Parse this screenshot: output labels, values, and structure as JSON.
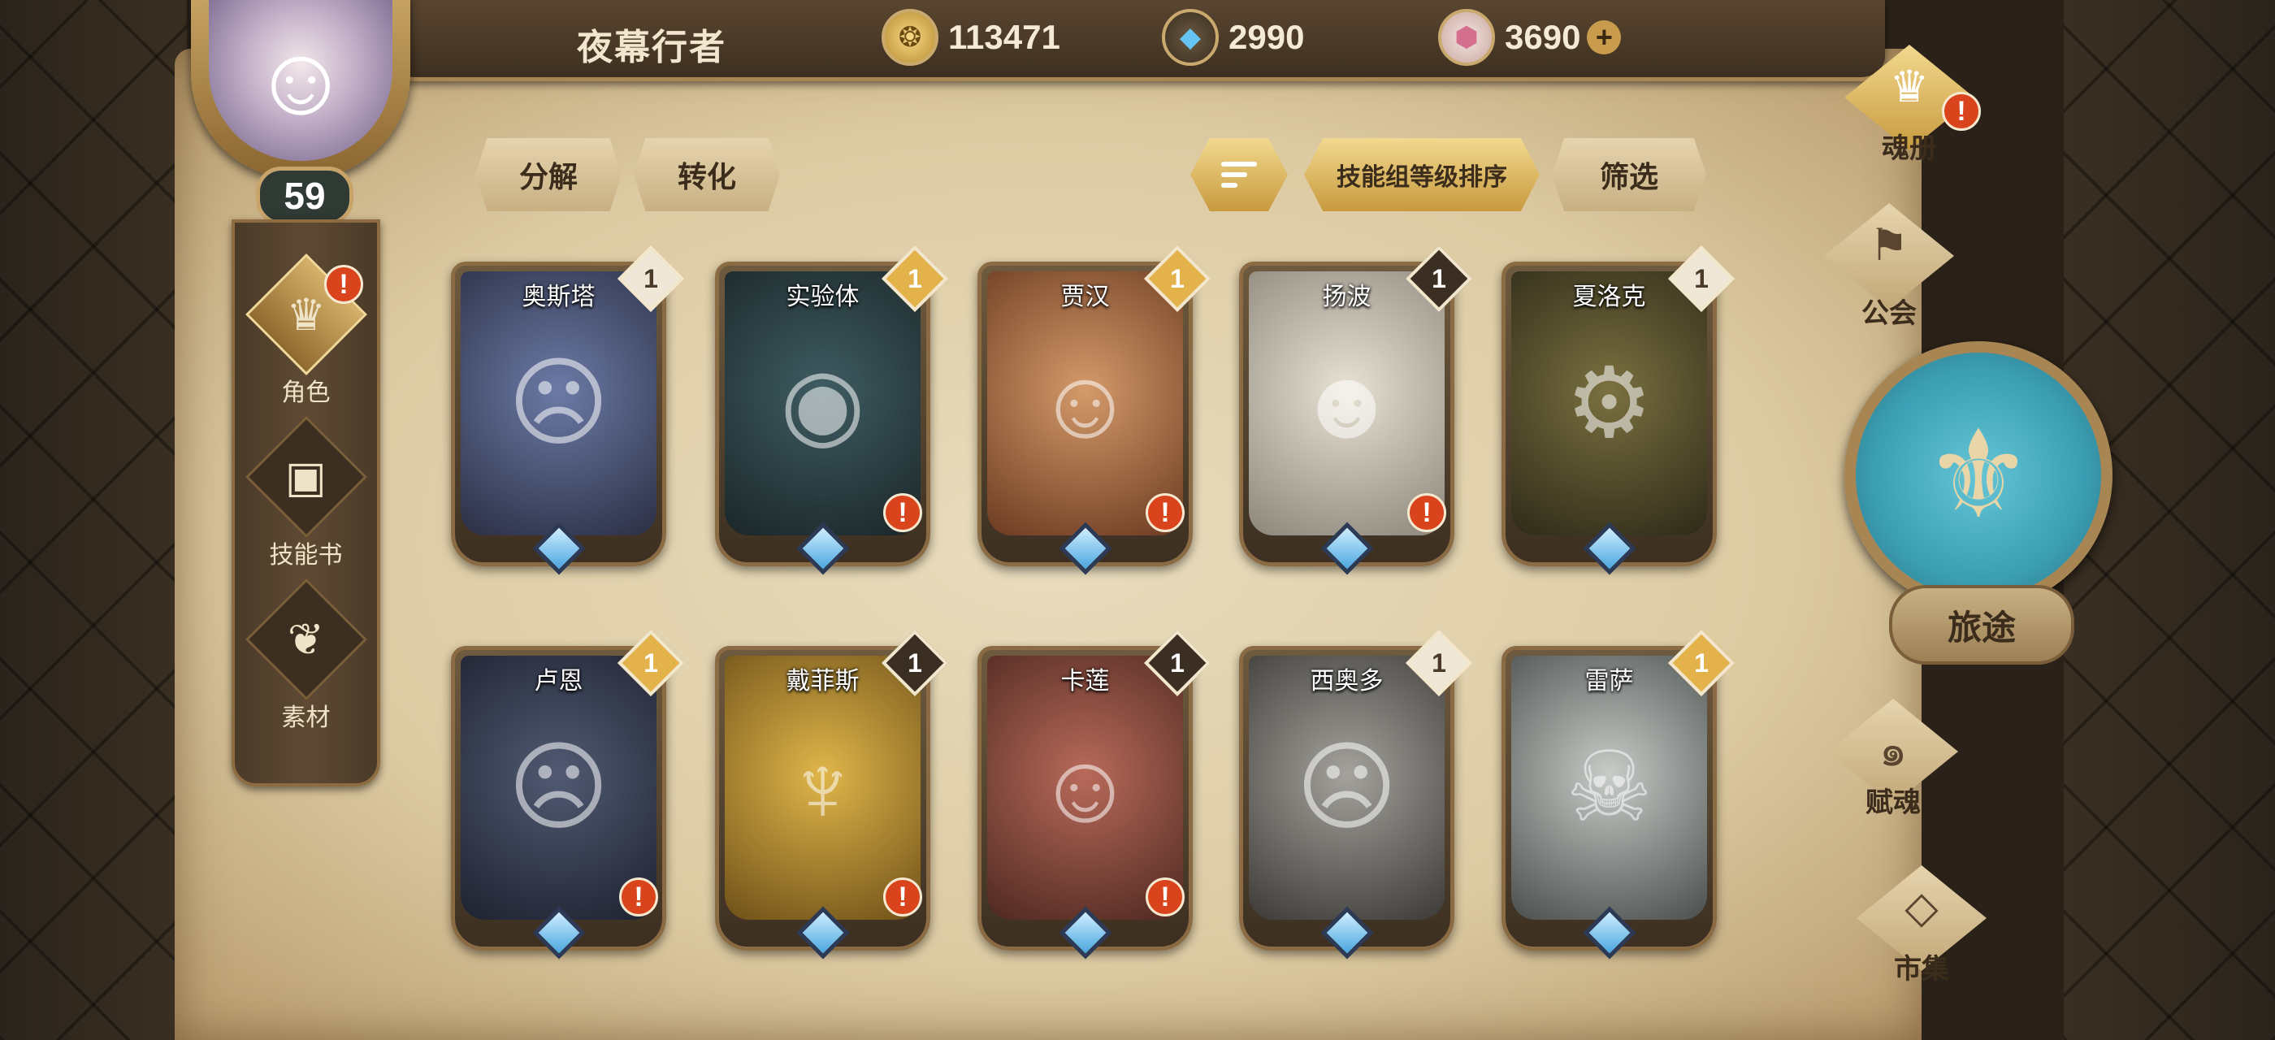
{
  "player": {
    "name": "夜幕行者",
    "level": "59"
  },
  "currencies": {
    "gold": {
      "icon": "gold-coin-icon",
      "value": "113471"
    },
    "crystal": {
      "icon": "blue-crystal-icon",
      "value": "2990"
    },
    "gem": {
      "icon": "pink-gem-icon",
      "value": "3690",
      "plus": "+"
    }
  },
  "left_nav": [
    {
      "label": "角色",
      "icon": "character-icon",
      "active": true,
      "alert": "!"
    },
    {
      "label": "技能书",
      "icon": "skill-book-icon",
      "active": false
    },
    {
      "label": "素材",
      "icon": "material-icon",
      "active": false
    }
  ],
  "actions": {
    "decompose": "分解",
    "convert": "转化",
    "sort_by": "技能组等级排序",
    "filter": "筛选"
  },
  "cards": [
    {
      "name": "奥斯塔",
      "rank": "1",
      "rank_color": "white",
      "alert": ""
    },
    {
      "name": "实验体",
      "rank": "1",
      "rank_color": "gold",
      "alert": "!"
    },
    {
      "name": "贾汉",
      "rank": "1",
      "rank_color": "gold",
      "alert": "!"
    },
    {
      "name": "扬波",
      "rank": "1",
      "rank_color": "dark",
      "alert": "!"
    },
    {
      "name": "夏洛克",
      "rank": "1",
      "rank_color": "white",
      "alert": ""
    },
    {
      "name": "卢恩",
      "rank": "1",
      "rank_color": "gold",
      "alert": "!"
    },
    {
      "name": "戴菲斯",
      "rank": "1",
      "rank_color": "dark",
      "alert": "!"
    },
    {
      "name": "卡莲",
      "rank": "1",
      "rank_color": "dark",
      "alert": "!"
    },
    {
      "name": "西奥多",
      "rank": "1",
      "rank_color": "white",
      "alert": ""
    },
    {
      "name": "雷萨",
      "rank": "1",
      "rank_color": "gold",
      "alert": ""
    }
  ],
  "right_nav": {
    "soul_book": {
      "label": "魂册",
      "icon": "soul-book-icon",
      "alert": "!"
    },
    "guild": {
      "label": "公会",
      "icon": "guild-icon"
    },
    "journey": {
      "label": "旅途",
      "icon": "journey-emblem-icon"
    },
    "endow": {
      "label": "赋魂",
      "icon": "endow-soul-icon"
    },
    "market": {
      "label": "市集",
      "icon": "market-icon"
    }
  },
  "colors": {
    "parchment": "#dccaa2",
    "accent_gold": "#c89a3e",
    "alert_red": "#d9441c",
    "journey_teal": "#3b9fb3"
  }
}
